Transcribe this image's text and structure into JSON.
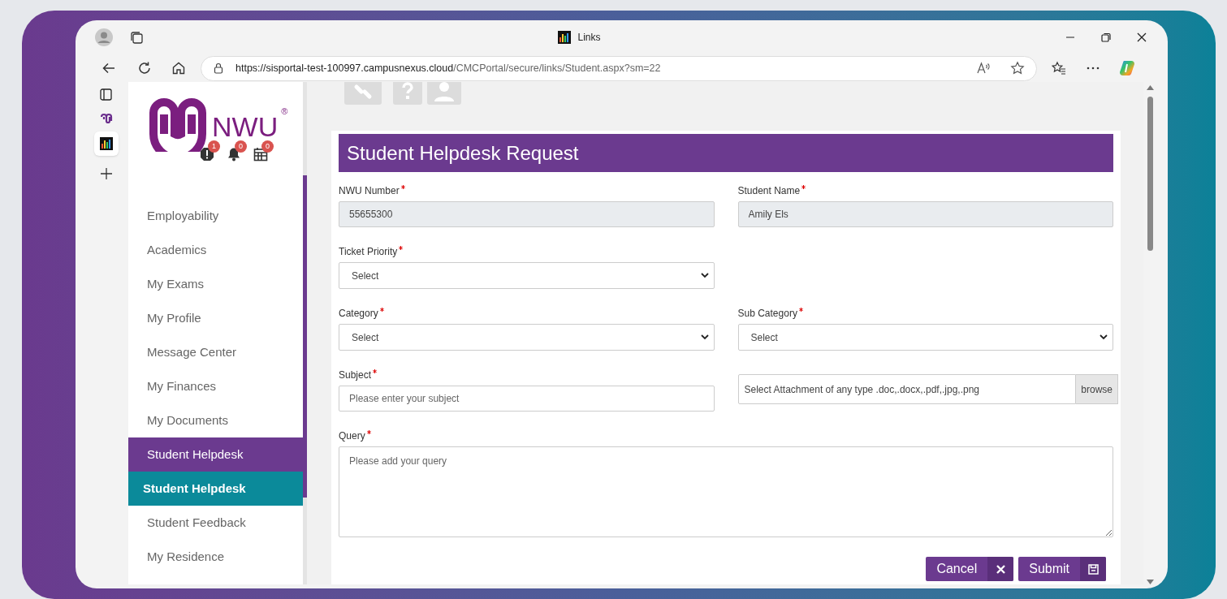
{
  "browser": {
    "tab_title": "Links",
    "url_host": "https://sisportal-test-100997.campusnexus.cloud",
    "url_path": "/CMCPortal/secure/links/Student.aspx?sm=22"
  },
  "logo": {
    "text": "NWU",
    "mark": "®"
  },
  "badges": [
    {
      "kind": "alert",
      "count": "1"
    },
    {
      "kind": "bell",
      "count": "0"
    },
    {
      "kind": "calendar",
      "count": "0"
    }
  ],
  "sidebar": {
    "items": [
      {
        "label": "Employability",
        "selected": false,
        "expanded": false
      },
      {
        "label": "Academics",
        "selected": false,
        "expanded": false
      },
      {
        "label": "My Exams",
        "selected": false,
        "expanded": false
      },
      {
        "label": "My Profile",
        "selected": false,
        "expanded": false
      },
      {
        "label": "Message Center",
        "selected": false,
        "expanded": false
      },
      {
        "label": "My Finances",
        "selected": false,
        "expanded": false
      },
      {
        "label": "My Documents",
        "selected": false,
        "expanded": false
      },
      {
        "label": "Student Helpdesk",
        "selected": false,
        "expanded": true,
        "children": [
          {
            "label": "Student Helpdesk",
            "selected": true
          }
        ]
      },
      {
        "label": "Student Feedback",
        "selected": false,
        "expanded": false
      },
      {
        "label": "My Residence",
        "selected": false,
        "expanded": false
      }
    ]
  },
  "form": {
    "title": "Student Helpdesk Request",
    "rows": [
      [
        {
          "kind": "readonly",
          "label": "NWU Number",
          "required": true,
          "value": "55655300"
        },
        {
          "kind": "readonly",
          "label": "Student Name",
          "required": true,
          "value": "Amily Els"
        }
      ],
      [
        {
          "kind": "select",
          "label": "Ticket Priority",
          "required": true,
          "value": "Select"
        }
      ],
      [
        {
          "kind": "select",
          "label": "Category",
          "required": true,
          "value": "Select"
        },
        {
          "kind": "select",
          "label": "Sub Category",
          "required": true,
          "value": "Select"
        }
      ],
      [
        {
          "kind": "text",
          "label": "Subject",
          "required": true,
          "placeholder": "Please enter your subject"
        },
        {
          "kind": "file",
          "placeholder": "Select Attachment of any type .doc,.docx,.pdf,.jpg,.png",
          "button": "browse"
        }
      ],
      [
        {
          "kind": "textarea",
          "label": "Query",
          "required": true,
          "placeholder": "Please add your query"
        }
      ]
    ],
    "buttons": [
      {
        "label": "Cancel"
      },
      {
        "label": "Submit"
      }
    ]
  }
}
